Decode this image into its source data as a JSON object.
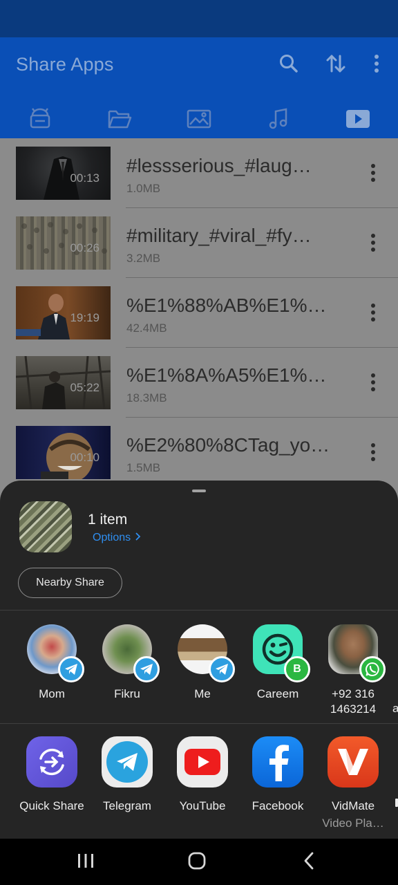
{
  "app_bar": {
    "title": "Share Apps",
    "actions": [
      "search-icon",
      "sort-icon",
      "more-vert-icon"
    ],
    "tabs": [
      "android-icon",
      "folder-icon",
      "image-icon",
      "music-icon",
      "video-icon"
    ],
    "selected_tab": 4
  },
  "videos": [
    {
      "title": "#lessserious_#laug…",
      "size": "1.0MB",
      "duration": "00:13"
    },
    {
      "title": "#military_#viral_#fy…",
      "size": "3.2MB",
      "duration": "00:26"
    },
    {
      "title": "%E1%88%AB%E1%8…",
      "size": "42.4MB",
      "duration": "19:19"
    },
    {
      "title": "%E1%8A%A5%E1%8…",
      "size": "18.3MB",
      "duration": "05:22"
    },
    {
      "title": "%E2%80%8CTag_yo…",
      "size": "1.5MB",
      "duration": "00:10"
    }
  ],
  "share_sheet": {
    "item_count": "1 item",
    "options_label": "Options",
    "nearby_share_label": "Nearby Share",
    "contacts": [
      {
        "name": "Mom",
        "badge": "telegram-icon"
      },
      {
        "name": "Fikru",
        "badge": "telegram-icon"
      },
      {
        "name": "Me",
        "badge": "telegram-icon"
      },
      {
        "name": "Careem",
        "badge": "whatsapp-business-icon"
      },
      {
        "name": "+92 316\n1463214",
        "badge": "whatsapp-icon"
      }
    ],
    "contacts_overflow_text": "a",
    "apps": [
      {
        "name": "Quick Share",
        "sub": ""
      },
      {
        "name": "Telegram",
        "sub": ""
      },
      {
        "name": "YouTube",
        "sub": ""
      },
      {
        "name": "Facebook",
        "sub": ""
      },
      {
        "name": "VidMate",
        "sub": "Video Pla…"
      }
    ]
  },
  "colors": {
    "app_bar": "#0a4fb6",
    "status_bar": "#0a3a7e",
    "sheet_background": "#252525",
    "link": "#2f8ff1"
  }
}
